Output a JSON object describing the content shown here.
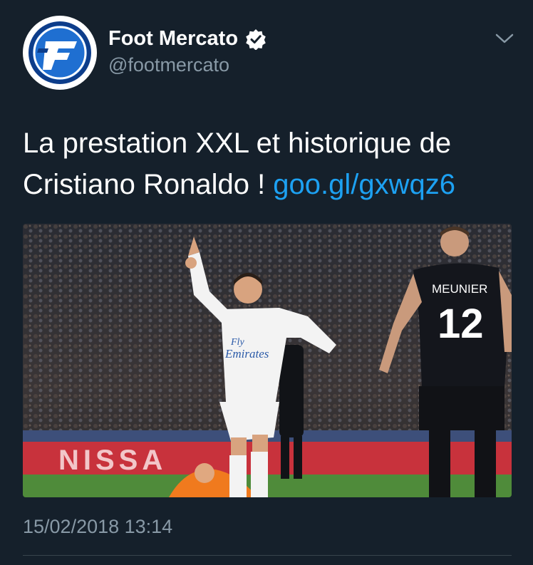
{
  "tweet": {
    "author_name": "Foot Mercato",
    "handle": "@footmercato",
    "text": "La prestation XXL et historique de Cristiano Ronaldo ! ",
    "link": "goo.gl/gxwqz6",
    "timestamp": "15/02/2018 13:14",
    "avatar_icon": "foot-mercato-logo",
    "verified_icon": "verified-badge-icon",
    "menu_icon": "chevron-down-icon"
  },
  "media": {
    "board_text": "NISSA",
    "shirt_name": "MEUNIER",
    "shirt_number": "12",
    "sponsor_line1": "Fly",
    "sponsor_line2": "Emirates"
  },
  "colors": {
    "background": "#15202b",
    "text": "#ffffff",
    "secondary_text": "#8899a6",
    "link": "#1da1f2",
    "divider": "#38444d"
  }
}
